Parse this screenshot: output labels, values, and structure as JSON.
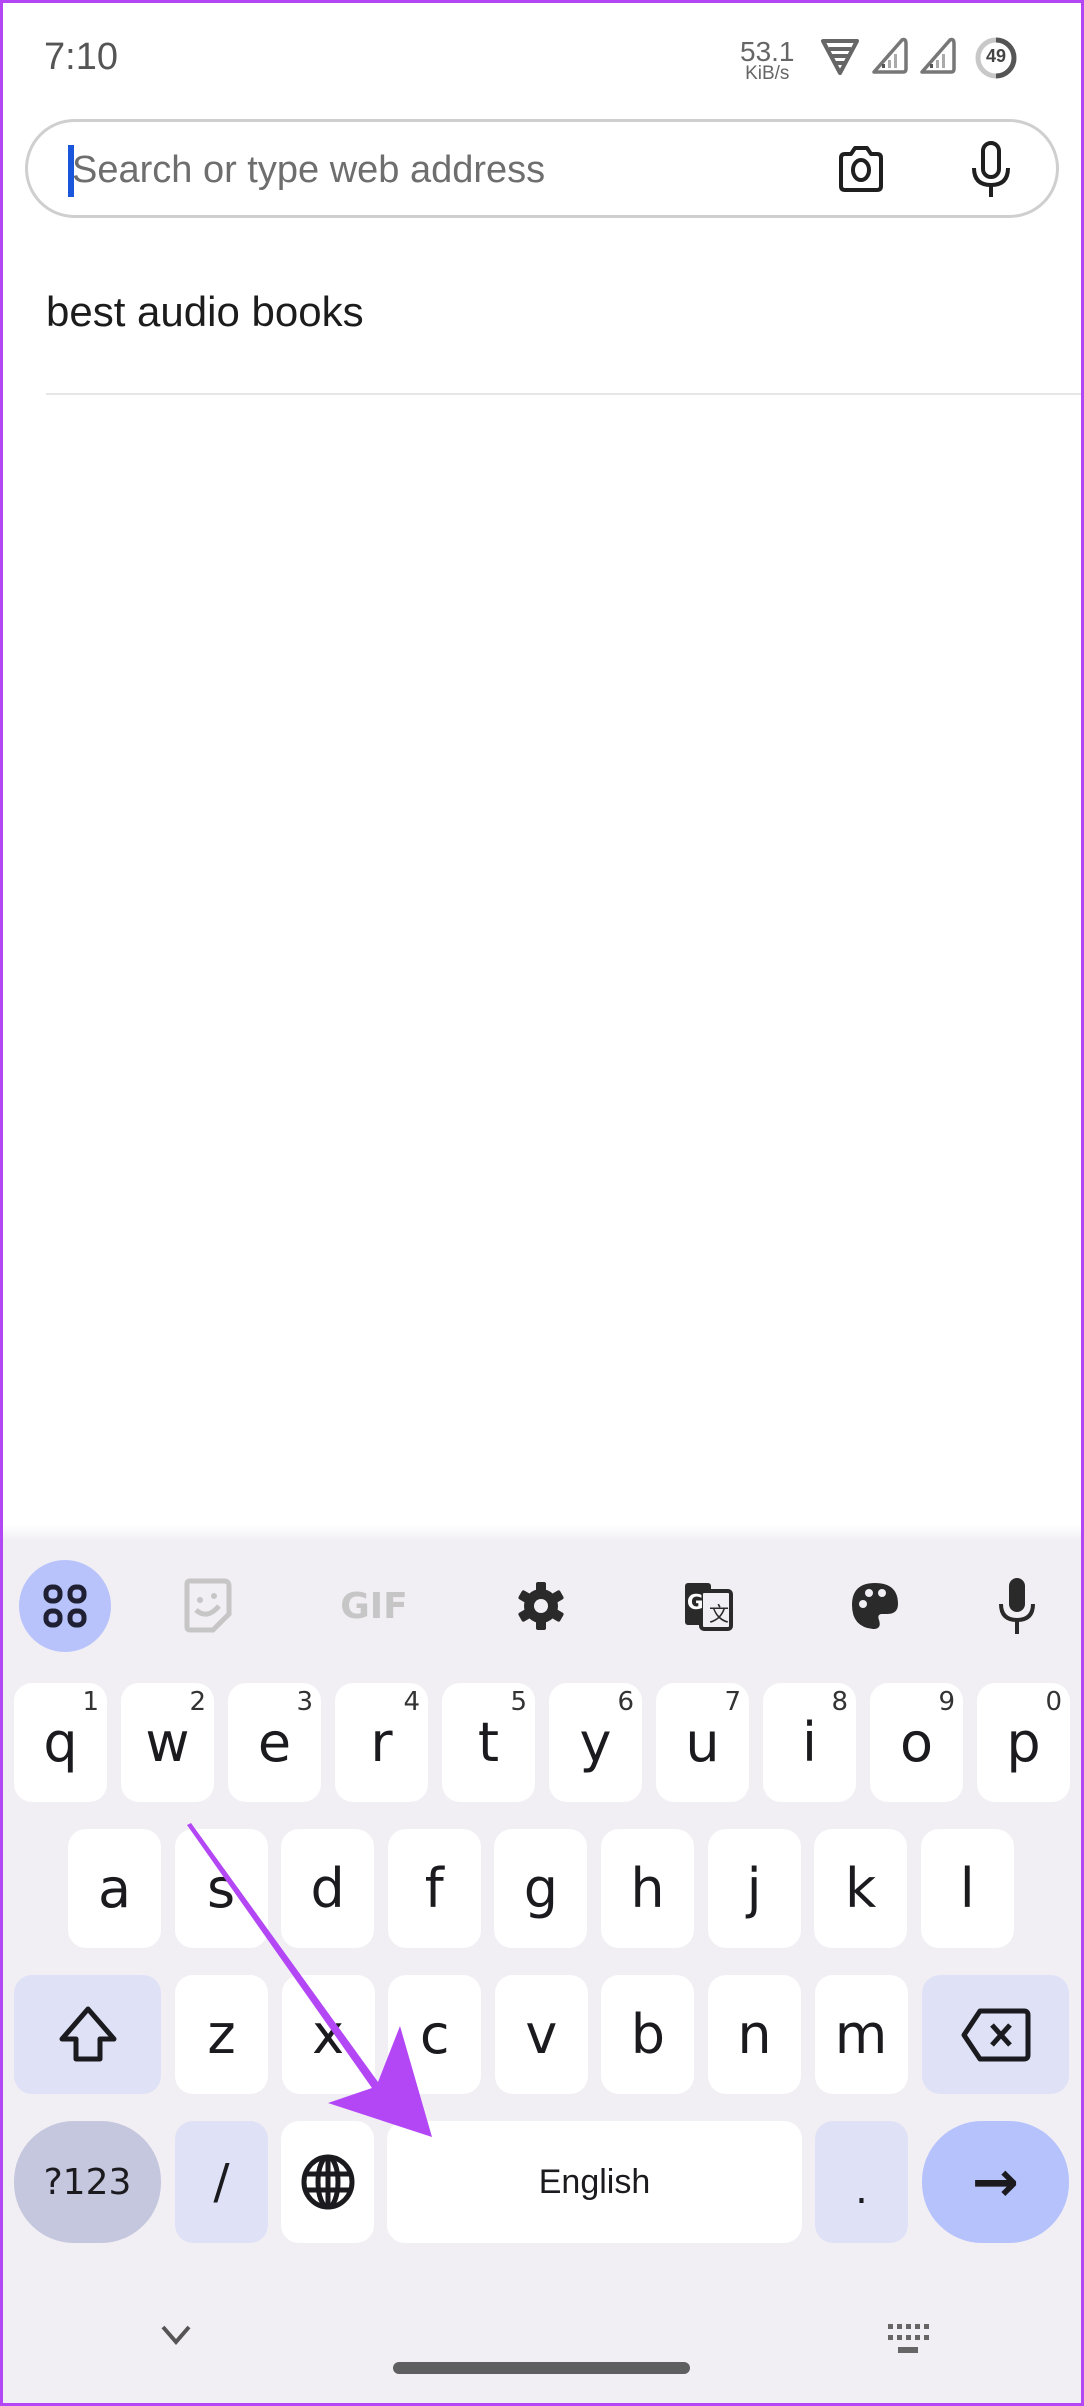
{
  "status_bar": {
    "time": "7:10",
    "net_speed_value": "53.1",
    "net_speed_unit": "KiB/s",
    "battery_percent": "49",
    "icons": [
      "wifi-icon",
      "signal-icon",
      "signal-icon",
      "battery-icon"
    ]
  },
  "search": {
    "placeholder": "Search or type web address",
    "value": "",
    "camera_icon": "camera-icon",
    "mic_icon": "mic-icon"
  },
  "suggestions": [
    {
      "text": "best audio books"
    }
  ],
  "keyboard": {
    "toolbar": [
      "apps-grid-icon",
      "sticker-icon",
      "gif-icon",
      "settings-icon",
      "translate-icon",
      "palette-icon",
      "mic-icon"
    ],
    "gif_label": "GIF",
    "row1": [
      {
        "k": "q",
        "h": "1"
      },
      {
        "k": "w",
        "h": "2"
      },
      {
        "k": "e",
        "h": "3"
      },
      {
        "k": "r",
        "h": "4"
      },
      {
        "k": "t",
        "h": "5"
      },
      {
        "k": "y",
        "h": "6"
      },
      {
        "k": "u",
        "h": "7"
      },
      {
        "k": "i",
        "h": "8"
      },
      {
        "k": "o",
        "h": "9"
      },
      {
        "k": "p",
        "h": "0"
      }
    ],
    "row2": [
      "a",
      "s",
      "d",
      "f",
      "g",
      "h",
      "j",
      "k",
      "l"
    ],
    "row3": [
      "z",
      "x",
      "c",
      "v",
      "b",
      "n",
      "m"
    ],
    "symbols_label": "?123",
    "slash_label": "/",
    "space_label": "English",
    "period_label": ".",
    "enter_label": "→",
    "shift_icon": "shift-icon",
    "backspace_icon": "backspace-icon",
    "globe_icon": "globe-icon"
  },
  "nav": {
    "hide_keyboard_icon": "chevron-down-icon",
    "keyboard_switch_icon": "keyboard-icon"
  },
  "annotation": {
    "color": "#b347f5",
    "points_to": "space-key"
  }
}
